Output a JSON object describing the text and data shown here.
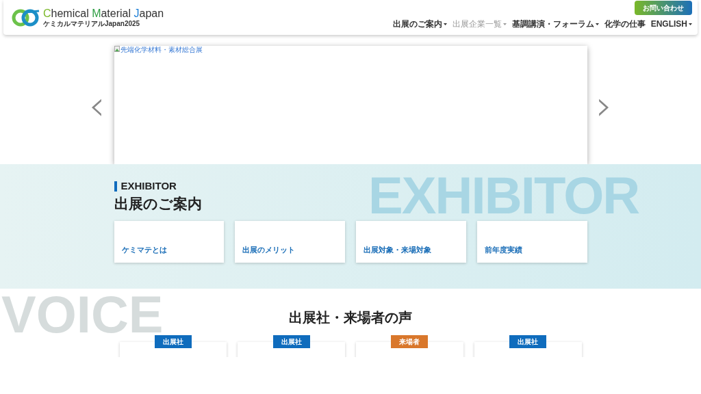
{
  "header": {
    "logo_title_parts": [
      "C",
      "hemical ",
      "M",
      "aterial ",
      "J",
      "apan"
    ],
    "logo_subtitle": "ケミカルマテリアルJapan2025",
    "contact_button": "お問い合わせ",
    "nav": [
      {
        "label": "出展のご案内",
        "dropdown": true,
        "disabled": false
      },
      {
        "label": "出展企業一覧",
        "dropdown": true,
        "disabled": true
      },
      {
        "label": "基調講演・フォーラム",
        "dropdown": true,
        "disabled": false
      },
      {
        "label": "化学の仕事",
        "dropdown": false,
        "disabled": false
      },
      {
        "label": "ENGLISH",
        "dropdown": true,
        "disabled": false
      }
    ]
  },
  "carousel": {
    "image_alt": "先端化学材料・素材総合展",
    "prev": "‹",
    "next": "›"
  },
  "exhibitor": {
    "background_word": "EXHIBITOR",
    "eyebrow": "EXHIBITOR",
    "title": "出展のご案内",
    "cards": [
      "ケミマテとは",
      "出展のメリット",
      "出展対象・来場対象",
      "前年度実績"
    ]
  },
  "voice": {
    "background_word": "VOICE",
    "title": "出展社・来場者の声",
    "cards": [
      {
        "tag": "出展社",
        "kind": "exhibitor"
      },
      {
        "tag": "出展社",
        "kind": "exhibitor"
      },
      {
        "tag": "来場者",
        "kind": "visitor"
      },
      {
        "tag": "出展社",
        "kind": "exhibitor"
      }
    ]
  }
}
